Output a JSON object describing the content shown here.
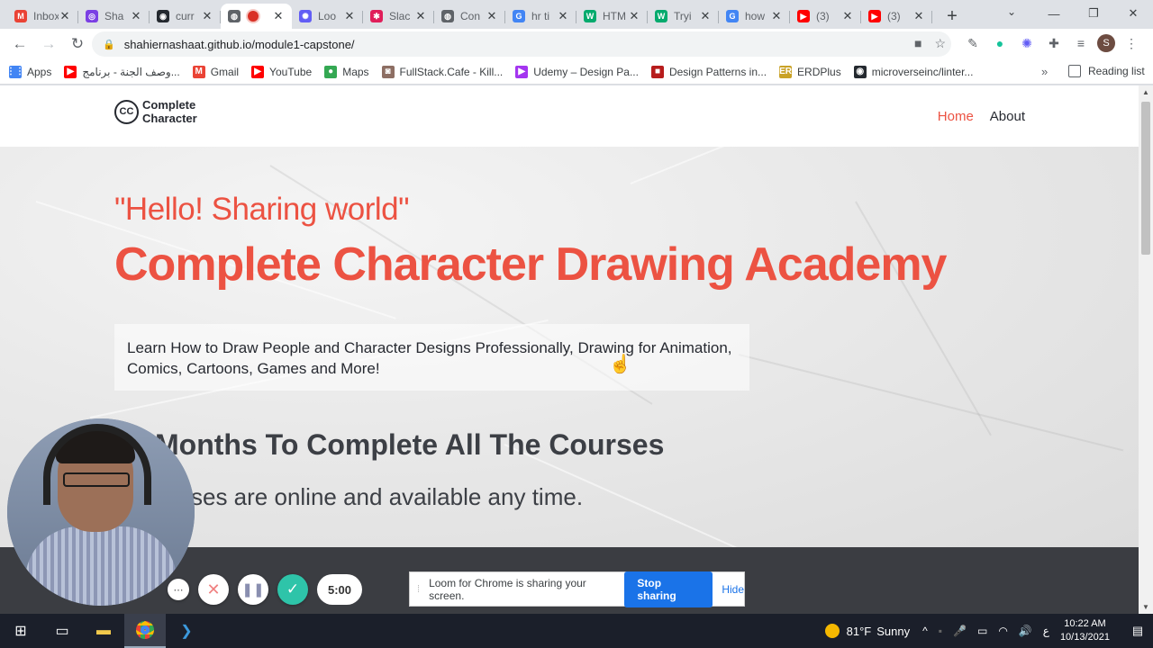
{
  "browser": {
    "tabs": [
      {
        "title": "Inbox",
        "icon": "gmail-icon",
        "color": "#ea4335",
        "glyph": "M"
      },
      {
        "title": "Sha",
        "icon": "app-icon",
        "color": "#7b3fe4",
        "glyph": "◎"
      },
      {
        "title": "curr",
        "icon": "github-icon",
        "color": "#24292f",
        "glyph": "◉"
      },
      {
        "title": "",
        "icon": "globe-icon",
        "color": "#5f6368",
        "glyph": "◍",
        "active": true,
        "recording": true
      },
      {
        "title": "Loo",
        "icon": "loom-icon",
        "color": "#625df5",
        "glyph": "✺"
      },
      {
        "title": "Slac",
        "icon": "slack-icon",
        "color": "#e01e5a",
        "glyph": "✱"
      },
      {
        "title": "Con",
        "icon": "globe-icon",
        "color": "#5f6368",
        "glyph": "◍"
      },
      {
        "title": "hr ti",
        "icon": "google-icon",
        "color": "#4285f4",
        "glyph": "G"
      },
      {
        "title": "HTM",
        "icon": "w3schools-icon",
        "color": "#04aa6d",
        "glyph": "W"
      },
      {
        "title": "Tryi",
        "icon": "w3schools-icon",
        "color": "#04aa6d",
        "glyph": "W"
      },
      {
        "title": "how",
        "icon": "google-icon",
        "color": "#4285f4",
        "glyph": "G"
      },
      {
        "title": "(3)",
        "icon": "youtube-icon",
        "color": "#ff0000",
        "glyph": "▶"
      },
      {
        "title": "(3)",
        "icon": "youtube-icon",
        "color": "#ff0000",
        "glyph": "▶"
      }
    ],
    "url": "shahiernashaat.github.io/module1-capstone/",
    "bookmarks": [
      {
        "label": "Apps",
        "icon": "apps-grid-icon",
        "color": "#4285f4",
        "glyph": "⋮⋮"
      },
      {
        "label": "وصف الجنة - برنامج...",
        "icon": "youtube-icon",
        "color": "#ff0000",
        "glyph": "▶"
      },
      {
        "label": "Gmail",
        "icon": "gmail-icon",
        "color": "#ea4335",
        "glyph": "M"
      },
      {
        "label": "YouTube",
        "icon": "youtube-icon",
        "color": "#ff0000",
        "glyph": "▶"
      },
      {
        "label": "Maps",
        "icon": "maps-pin-icon",
        "color": "#34a853",
        "glyph": "●"
      },
      {
        "label": "FullStack.Cafe - Kill...",
        "icon": "fullstack-cafe-icon",
        "color": "#8d6e63",
        "glyph": "◙"
      },
      {
        "label": "Udemy – Design Pa...",
        "icon": "udemy-icon",
        "color": "#a435f0",
        "glyph": "▶"
      },
      {
        "label": "Design Patterns in...",
        "icon": "refactoring-guru-icon",
        "color": "#b71c1c",
        "glyph": "■"
      },
      {
        "label": "ERDPlus",
        "icon": "erdplus-icon",
        "color": "#c9a227",
        "glyph": "ER"
      },
      {
        "label": "microverseinc/linter...",
        "icon": "github-icon",
        "color": "#24292f",
        "glyph": "◉"
      }
    ],
    "reading_list": "Reading list"
  },
  "site": {
    "logo_line1": "Complete",
    "logo_line2": "Character",
    "logo_badge": "CC",
    "nav": [
      {
        "label": "Home",
        "active": true
      },
      {
        "label": "About",
        "active": false
      }
    ],
    "greeting": "\"Hello! Sharing world\"",
    "title": "Complete Character Drawing Academy",
    "intro": "Learn How to Draw People and Character Designs Professionally, Drawing for Animation, Comics, Cartoons, Games and More!",
    "months_heading": "Months To Complete All The Courses",
    "online_text": "ses are online and available any time.",
    "accent_color": "#ec5242"
  },
  "loom": {
    "timer": "5:00",
    "share_message": "Loom for Chrome is sharing your screen.",
    "stop_label": "Stop sharing",
    "hide_label": "Hide"
  },
  "taskbar": {
    "weather_temp": "81°F",
    "weather_desc": "Sunny",
    "lang": "ع",
    "time": "10:22 AM",
    "date": "10/13/2021"
  }
}
